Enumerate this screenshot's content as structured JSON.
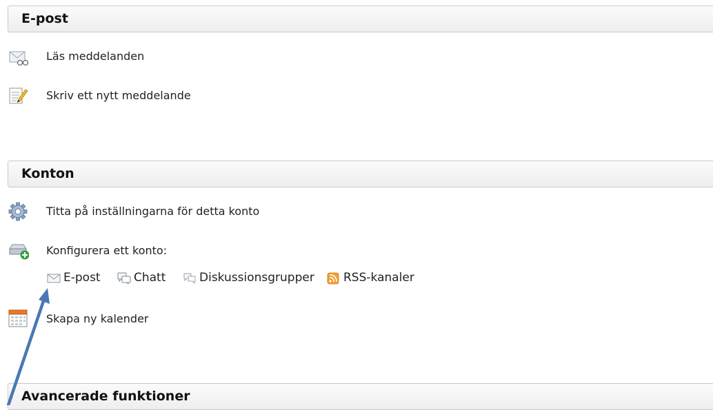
{
  "sections": {
    "email": {
      "title": "E-post"
    },
    "accounts": {
      "title": "Konton"
    },
    "advanced": {
      "title": "Avancerade funktioner"
    }
  },
  "email_items": {
    "read": {
      "label": "Läs meddelanden",
      "icon": "read-mail-icon"
    },
    "compose": {
      "label": "Skriv ett nytt meddelande",
      "icon": "compose-icon"
    }
  },
  "account_items": {
    "settings": {
      "label": "Titta på inställningarna för detta konto",
      "icon": "gear-icon"
    },
    "setup": {
      "label": "Konfigurera ett konto:",
      "icon": "add-account-icon"
    },
    "calendar": {
      "label": "Skapa ny kalender",
      "icon": "calendar-icon"
    }
  },
  "account_types": [
    {
      "label": "E-post",
      "icon": "envelope-icon"
    },
    {
      "label": "Chatt",
      "icon": "chat-icon"
    },
    {
      "label": "Diskussionsgrupper",
      "icon": "newsgroup-icon"
    },
    {
      "label": "RSS-kanaler",
      "icon": "rss-icon"
    }
  ],
  "colors": {
    "arrow": "#4a78b4",
    "rss": "#f0a030"
  }
}
